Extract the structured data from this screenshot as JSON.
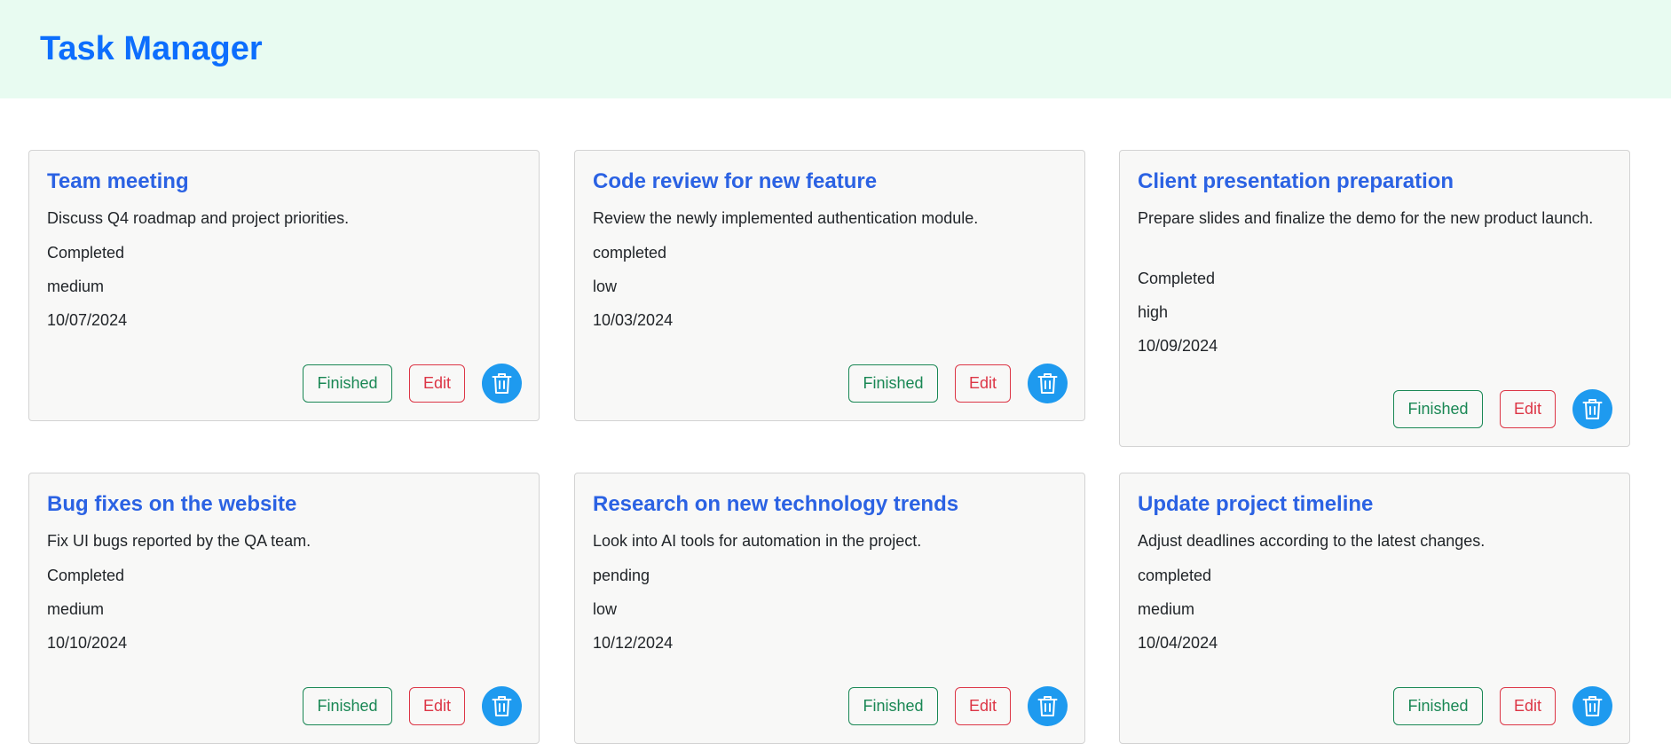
{
  "app": {
    "title": "Task Manager"
  },
  "buttons": {
    "finished": "Finished",
    "edit": "Edit"
  },
  "tasks": [
    {
      "title": "Team meeting",
      "description": "Discuss Q4 roadmap and project priorities.",
      "status": "Completed",
      "priority": "medium",
      "date": "10/07/2024"
    },
    {
      "title": "Code review for new feature",
      "description": "Review the newly implemented authentication module.",
      "status": "completed",
      "priority": "low",
      "date": "10/03/2024"
    },
    {
      "title": "Client presentation preparation",
      "description": "Prepare slides and finalize the demo for the new product launch.",
      "status": "Completed",
      "priority": "high",
      "date": "10/09/2024"
    },
    {
      "title": "Bug fixes on the website",
      "description": "Fix UI bugs reported by the QA team.",
      "status": "Completed",
      "priority": "medium",
      "date": "10/10/2024"
    },
    {
      "title": "Research on new technology trends",
      "description": "Look into AI tools for automation in the project.",
      "status": "pending",
      "priority": "low",
      "date": "10/12/2024"
    },
    {
      "title": "Update project timeline",
      "description": "Adjust deadlines according to the latest changes.",
      "status": "completed",
      "priority": "medium",
      "date": "10/04/2024"
    }
  ],
  "colors": {
    "header_bg": "#e8fbf1",
    "title_blue": "#0d6efd",
    "card_title": "#2b62e3",
    "finished_green": "#198754",
    "edit_red": "#dc3545",
    "delete_blue": "#1e9aef"
  },
  "icons": {
    "delete": "trash-icon"
  }
}
